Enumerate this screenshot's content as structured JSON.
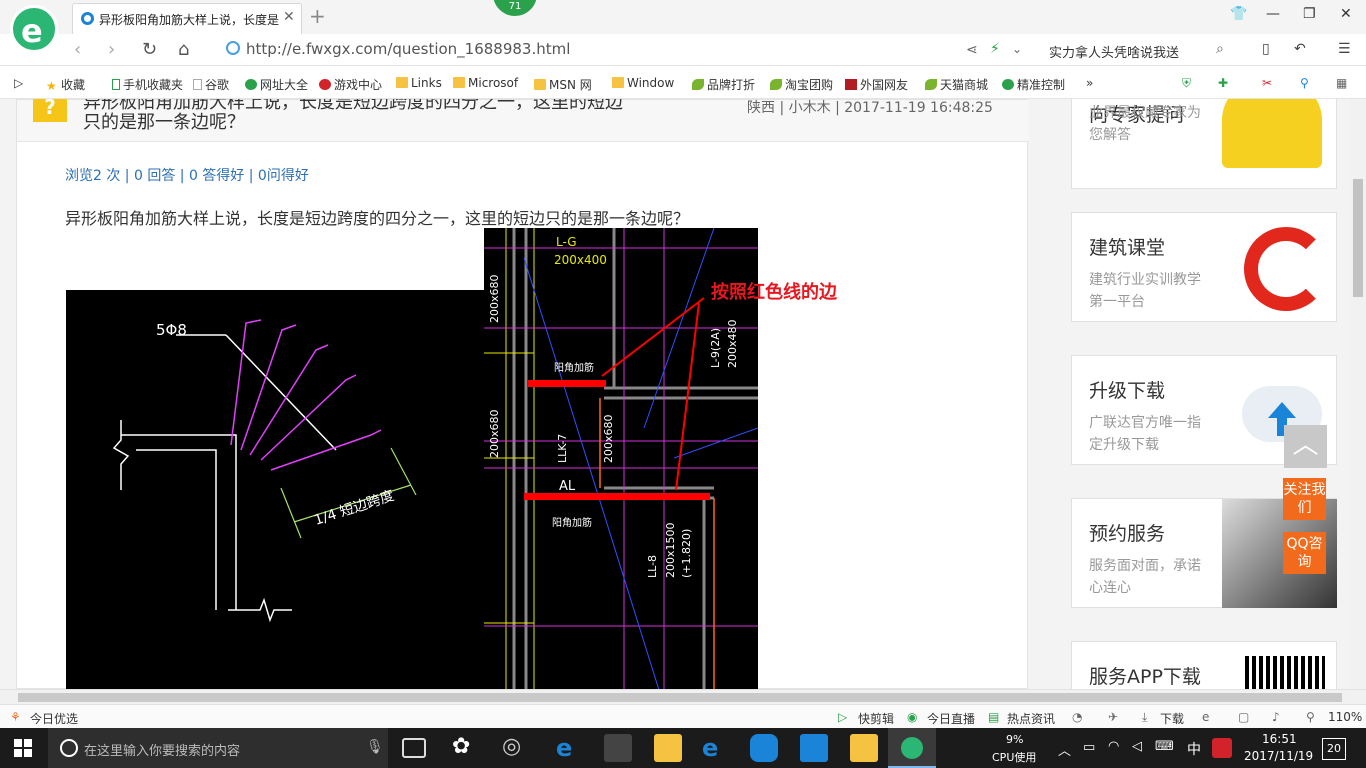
{
  "browser": {
    "tab_title": "异形板阳角加筋大样上说，长度是",
    "badge": "71",
    "url": "http://e.fwxgx.com/question_1688983.html",
    "search_hint": "实力拿人头凭啥说我送"
  },
  "bookmarks": [
    "收藏",
    "手机收藏夹",
    "谷歌",
    "网址大全",
    "游戏中心",
    "Links",
    "Microsof",
    "MSN 网",
    "Window",
    "品牌打折",
    "淘宝团购",
    "外国网友",
    "天猫商城",
    "精准控制"
  ],
  "question": {
    "title_line1": "异形板阳角加筋大样上说，长度是短边跨度的四分之一，这里的短边",
    "title_line2": "只的是那一条边呢？",
    "meta": "陕西 | 小木木 | 2017-11-19 16:48:25",
    "stats": "浏览2 次 | 0 回答 | 0 答得好 | 0问得好",
    "body": "异形板阳角加筋大样上说，长度是短边跨度的四分之一，这里的短边只的是那一条边呢？"
  },
  "drawing": {
    "label_5phi8": "5Φ8",
    "label_quarter": "1/4 短边跨度",
    "label_lg": "L-G",
    "label_200x400": "200x400",
    "label_200x680": "200x680",
    "label_yjjj": "阳角加筋",
    "label_llk7": "LLK-7",
    "label_l9": "L-9(2A)",
    "label_200x480": "200x480",
    "label_al": "AL",
    "label_ll8": "LL-8",
    "label_200x1500": "200x1500",
    "label_elev": "(+1.820)",
    "annotation": "按照红色线的边"
  },
  "sidebar": {
    "cards": [
      {
        "title": "向专家提问",
        "desc": "业界最权威专家为您解答"
      },
      {
        "title": "建筑课堂",
        "desc": "建筑行业实训教学第一平台"
      },
      {
        "title": "升级下载",
        "desc": "广联达官方唯一指定升级下载"
      },
      {
        "title": "预约服务",
        "desc": "服务面对面，承诺心连心"
      },
      {
        "title": "服务APP下载",
        "desc": ""
      }
    ],
    "follow": "关注我们",
    "qq": "QQ咨询",
    "top_arrow": "︿"
  },
  "statusbar": {
    "left": "今日优选",
    "items": [
      "快剪辑",
      "今日直播",
      "热点资讯",
      "下载"
    ],
    "zoom": "110%"
  },
  "taskbar": {
    "search_placeholder": "在这里输入你要搜索的内容",
    "cpu_pct": "9%",
    "cpu_label": "CPU使用",
    "ime": "中",
    "time": "16:51",
    "date": "2017/11/19",
    "notif": "20"
  }
}
